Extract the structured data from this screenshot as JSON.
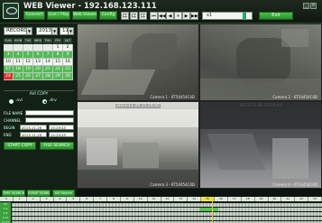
{
  "app": {
    "title": "WEB Viewer - 192.168.123.111",
    "menu": [
      "Connect",
      "Live / Play",
      "Web Viewer",
      "Config"
    ],
    "layout_buttons": 4,
    "playback_controls": [
      "⏮",
      "◀◀",
      "◀",
      "⏸",
      "▶",
      "▶▶"
    ],
    "speed_label": "x1",
    "exit_label": "Exit",
    "window_buttons": [
      "_",
      "□",
      "×"
    ]
  },
  "left": {
    "mode": "RECORD",
    "year": "2013",
    "month": "11",
    "weekdays": [
      "SUN",
      "MON",
      "TUE",
      "WED",
      "THU",
      "FRI",
      "SAT"
    ],
    "days": [
      [
        "",
        "",
        "",
        "",
        "",
        "1",
        "2"
      ],
      [
        "3",
        "4",
        "5",
        "6",
        "7",
        "8",
        "9"
      ],
      [
        "10",
        "11",
        "12",
        "13",
        "14",
        "15",
        "16"
      ],
      [
        "17",
        "18",
        "19",
        "20",
        "21",
        "22",
        "23"
      ],
      [
        "24",
        "25",
        "26",
        "27",
        "28",
        "29",
        "30"
      ]
    ],
    "recorded_days": [
      "3",
      "4",
      "5",
      "6",
      "7",
      "8",
      "9",
      "17",
      "18",
      "19",
      "20",
      "21",
      "22",
      "23",
      "24",
      "25",
      "26",
      "27",
      "28",
      "29",
      "30"
    ],
    "selected_day": "24",
    "avi": {
      "title": "AVI COPY",
      "option_a": ".avi",
      "option_b": ".drv",
      "selected": "b",
      "file_name_label": "FILE NAME",
      "file_name_value": "",
      "channel_label": "CHANNEL",
      "channel_value": "",
      "begin_label": "BEGIN",
      "begin_date": "2013-11-26",
      "begin_time": "15:29:45",
      "end_label": "END",
      "end_date": "2013-11-26",
      "end_time": "15:29:45",
      "start_copy": "START COPY",
      "file_search": "FILE SEARCH"
    },
    "tabs": [
      "TIME SEARCH",
      "EVENT SEARCH",
      "AVI Search"
    ]
  },
  "cameras": [
    {
      "label": "Camera 1 - 6T54454C4D",
      "timestamp": "2013-11-26 15:29:45"
    },
    {
      "label": "Camera 2 - 6T54454C4D",
      "timestamp": "2013-11-26 15:29:45"
    },
    {
      "label": "Camera 3 - 6T54454C4D",
      "timestamp": "2013-11-26 15:29:45"
    },
    {
      "label": "Camera 4 - 6T54454C4D",
      "timestamp": "2013-11-26 15:29:45"
    }
  ],
  "timeline": {
    "hours": [
      "0",
      "1",
      "2",
      "3",
      "4",
      "5",
      "6",
      "7",
      "8",
      "9",
      "10",
      "11",
      "12",
      "13",
      "14",
      "15",
      "16",
      "17",
      "18",
      "19",
      "20",
      "21",
      "22",
      "23"
    ],
    "current_hour": "15",
    "rows": [
      {
        "label": "CH",
        "record_from_hour": null,
        "record_to_hour": null
      },
      {
        "label": "1-4",
        "record_from_hour": 14.5,
        "record_to_hour": 16.0
      },
      {
        "label": "5-8",
        "record_from_hour": null,
        "record_to_hour": null
      },
      {
        "label": "9-12",
        "record_from_hour": null,
        "record_to_hour": null
      },
      {
        "label": "13-16",
        "record_from_hour": null,
        "record_to_hour": null
      }
    ],
    "cursor_hour": 15.5
  },
  "colors": {
    "accent_green": "#47c247",
    "record_green": "#53c255",
    "selected_red": "#e33232",
    "current_hour_yellow": "#f1e24a"
  }
}
